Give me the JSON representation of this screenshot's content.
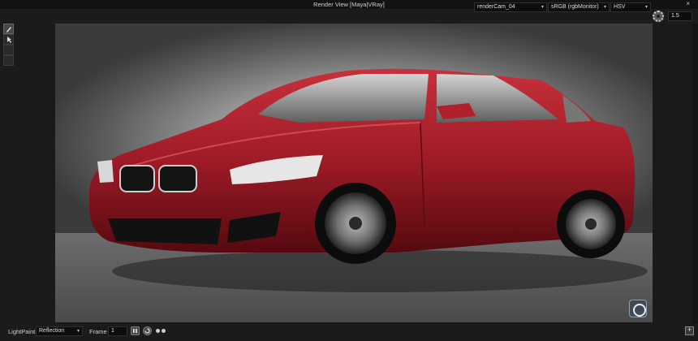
{
  "window": {
    "title": "Render View [Maya|VRay]",
    "close_symbol": "×"
  },
  "toolbar": {
    "camera": "renderCam_04",
    "color_space": "sRGB (rgbMonitor)",
    "color_mode": "HSV",
    "exposure_value": "1.5",
    "dropdown_arrow": "▾"
  },
  "tools": [
    {
      "name": "paint-brush-icon",
      "active": true
    },
    {
      "name": "select-arrow-icon",
      "active": false
    },
    {
      "name": "tool-slot-3-icon",
      "active": false
    },
    {
      "name": "tool-slot-4-icon",
      "active": false
    }
  ],
  "statusbar": {
    "lightpaint_label": "LightPaint",
    "lightpaint_mode": "Reflection",
    "frame_label": "Frame",
    "frame_value": "1"
  },
  "colors": {
    "car_body": "#9e1b27",
    "accent_blue": "#8da0b5"
  }
}
